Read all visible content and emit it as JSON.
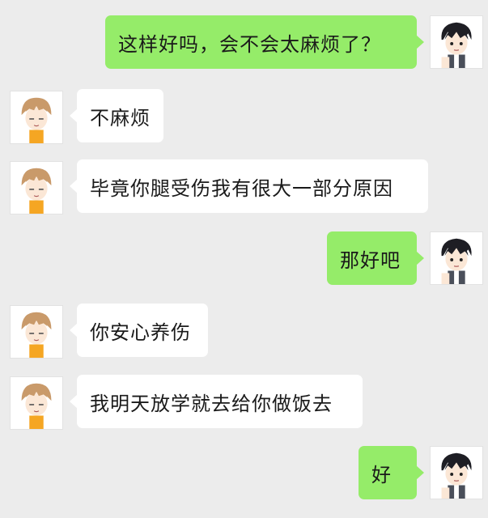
{
  "chat": {
    "messages": [
      {
        "side": "right",
        "avatar": "dark-hair-boy-avatar-icon",
        "text": "这样好吗，会不会太麻烦了？"
      },
      {
        "side": "left",
        "avatar": "brown-hair-boy-avatar-icon",
        "text": "不麻烦"
      },
      {
        "side": "left",
        "avatar": "brown-hair-boy-avatar-icon",
        "text": "毕竟你腿受伤我有很大一部分原因"
      },
      {
        "side": "right",
        "avatar": "dark-hair-boy-avatar-icon",
        "text": "那好吧"
      },
      {
        "side": "left",
        "avatar": "brown-hair-boy-avatar-icon",
        "text": "你安心养伤"
      },
      {
        "side": "left",
        "avatar": "brown-hair-boy-avatar-icon",
        "text": "我明天放学就去给你做饭去"
      },
      {
        "side": "right",
        "avatar": "dark-hair-boy-avatar-icon",
        "text": "好"
      }
    ]
  },
  "colors": {
    "background": "#ececec",
    "outgoing_bubble": "#95ec69",
    "incoming_bubble": "#ffffff"
  }
}
